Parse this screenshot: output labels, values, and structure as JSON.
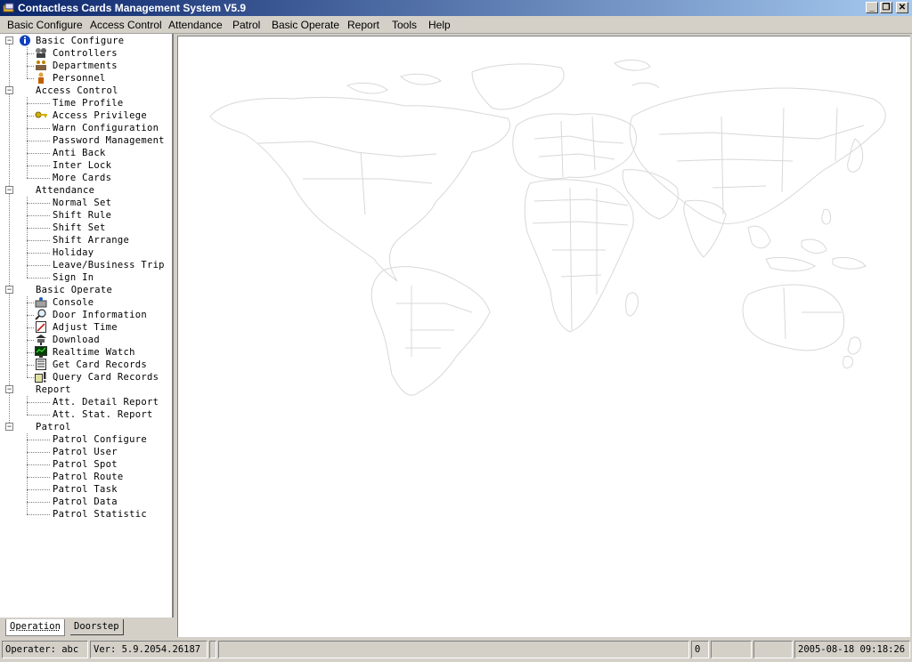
{
  "window": {
    "title": "Contactless Cards Management System  V5.9",
    "minimize_glyph": "_",
    "restore_glyph": "❐",
    "close_glyph": "✕"
  },
  "menubar": [
    {
      "label": "Basic Configure"
    },
    {
      "label": "Access Control"
    },
    {
      "label": "Attendance"
    },
    {
      "label": "Patrol"
    },
    {
      "label": "Basic Operate"
    },
    {
      "label": "Report"
    },
    {
      "label": "Tools"
    },
    {
      "label": "Help"
    }
  ],
  "tree": {
    "groups": [
      {
        "label": "Basic Configure",
        "icon": "info-icon",
        "items": [
          {
            "label": "Controllers",
            "icon": "controllers-icon"
          },
          {
            "label": "Departments",
            "icon": "departments-icon"
          },
          {
            "label": "Personnel",
            "icon": "person-icon"
          }
        ]
      },
      {
        "label": "Access Control",
        "items": [
          {
            "label": "Time Profile"
          },
          {
            "label": "Access Privilege",
            "icon": "key-icon"
          },
          {
            "label": "Warn Configuration"
          },
          {
            "label": "Password Management"
          },
          {
            "label": "Anti Back"
          },
          {
            "label": "Inter Lock"
          },
          {
            "label": "More Cards"
          }
        ]
      },
      {
        "label": "Attendance",
        "items": [
          {
            "label": "Normal Set"
          },
          {
            "label": "Shift Rule"
          },
          {
            "label": "Shift Set"
          },
          {
            "label": "Shift Arrange"
          },
          {
            "label": "Holiday"
          },
          {
            "label": "Leave/Business Trip"
          },
          {
            "label": "Sign In"
          }
        ]
      },
      {
        "label": "Basic Operate",
        "items": [
          {
            "label": "Console",
            "icon": "console-icon"
          },
          {
            "label": "Door Information",
            "icon": "magnifier-icon"
          },
          {
            "label": "Adjust Time",
            "icon": "adjust-time-icon"
          },
          {
            "label": "Download",
            "icon": "download-icon"
          },
          {
            "label": "Realtime Watch",
            "icon": "monitor-icon"
          },
          {
            "label": "Get Card Records",
            "icon": "records-icon"
          },
          {
            "label": "Query Card Records",
            "icon": "query-icon"
          }
        ]
      },
      {
        "label": "Report",
        "items": [
          {
            "label": "Att. Detail Report"
          },
          {
            "label": "Att. Stat. Report"
          }
        ]
      },
      {
        "label": "Patrol",
        "items": [
          {
            "label": "Patrol Configure"
          },
          {
            "label": "Patrol User"
          },
          {
            "label": "Patrol Spot"
          },
          {
            "label": "Patrol Route"
          },
          {
            "label": "Patrol Task"
          },
          {
            "label": "Patrol Data"
          },
          {
            "label": "Patrol Statistic"
          }
        ]
      }
    ]
  },
  "tabs": [
    {
      "label": "Operation",
      "active": true
    },
    {
      "label": "Doorstep",
      "active": false
    }
  ],
  "statusbar": {
    "operator": "Operater: abc",
    "version": "Ver: 5.9.2054.26187",
    "count": "0",
    "datetime": "2005-08-18 09:18:26"
  },
  "colors": {
    "titlebar_start": "#0a246a",
    "titlebar_end": "#a6caf0",
    "map_outline": "#d8d8d8"
  }
}
